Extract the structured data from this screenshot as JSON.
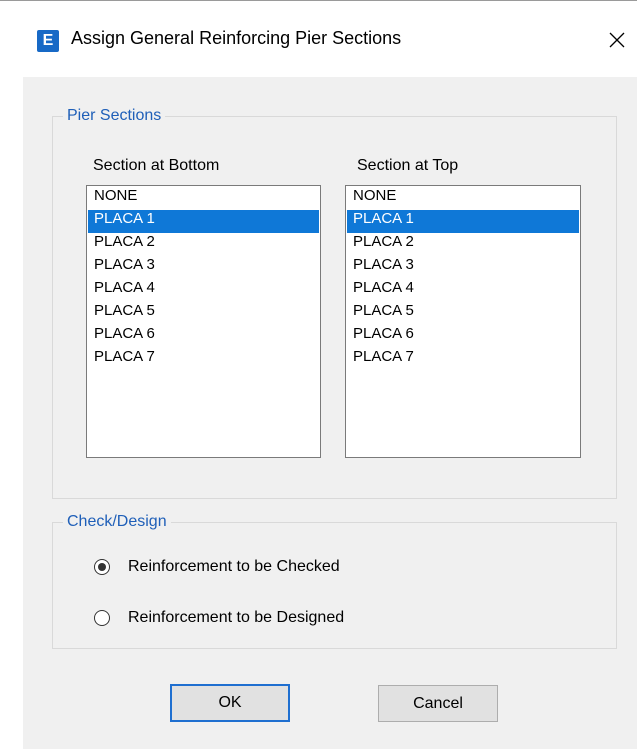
{
  "window": {
    "title": "Assign General Reinforcing Pier Sections",
    "app_icon_letter": "E"
  },
  "pier_sections": {
    "legend": "Pier Sections",
    "bottom": {
      "label": "Section at Bottom",
      "items": [
        "NONE",
        "PLACA 1",
        "PLACA 2",
        "PLACA 3",
        "PLACA 4",
        "PLACA 5",
        "PLACA 6",
        "PLACA 7"
      ],
      "selected": "PLACA 1"
    },
    "top": {
      "label": "Section at Top",
      "items": [
        "NONE",
        "PLACA 1",
        "PLACA 2",
        "PLACA 3",
        "PLACA 4",
        "PLACA 5",
        "PLACA 6",
        "PLACA 7"
      ],
      "selected": "PLACA 1"
    }
  },
  "check_design": {
    "legend": "Check/Design",
    "options": [
      {
        "label": "Reinforcement to be Checked",
        "checked": true
      },
      {
        "label": "Reinforcement to be Designed",
        "checked": false
      }
    ]
  },
  "buttons": {
    "ok_label": "OK",
    "cancel_label": "Cancel"
  },
  "colors": {
    "selection": "#0f78d7",
    "legend_text": "#1f5fb8",
    "app_icon": "#1769c6"
  },
  "icons": {
    "app": "etabs-app-icon",
    "close": "close-icon"
  }
}
